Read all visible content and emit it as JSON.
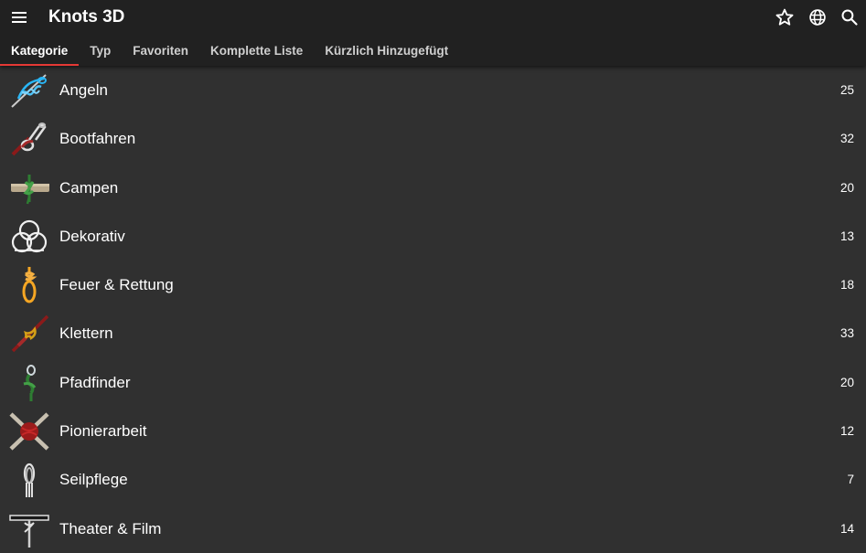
{
  "app": {
    "title": "Knots 3D"
  },
  "toolbar": {
    "menu_icon": "menu-icon",
    "actions": [
      "star-icon",
      "globe-icon",
      "search-icon"
    ]
  },
  "tabs": [
    {
      "label": "Kategorie",
      "active": true
    },
    {
      "label": "Typ",
      "active": false
    },
    {
      "label": "Favoriten",
      "active": false
    },
    {
      "label": "Komplette Liste",
      "active": false
    },
    {
      "label": "Kürzlich Hinzugefügt",
      "active": false
    }
  ],
  "categories": [
    {
      "label": "Angeln",
      "count": "25",
      "icon": "fishing-knot-icon"
    },
    {
      "label": "Bootfahren",
      "count": "32",
      "icon": "boating-knot-icon"
    },
    {
      "label": "Campen",
      "count": "20",
      "icon": "camping-knot-icon"
    },
    {
      "label": "Dekorativ",
      "count": "13",
      "icon": "decorative-knot-icon"
    },
    {
      "label": "Feuer & Rettung",
      "count": "18",
      "icon": "rescue-knot-icon"
    },
    {
      "label": "Klettern",
      "count": "33",
      "icon": "climbing-knot-icon"
    },
    {
      "label": "Pfadfinder",
      "count": "20",
      "icon": "scouting-knot-icon"
    },
    {
      "label": "Pionierarbeit",
      "count": "12",
      "icon": "pioneering-knot-icon"
    },
    {
      "label": "Seilpflege",
      "count": "7",
      "icon": "rope-care-icon"
    },
    {
      "label": "Theater & Film",
      "count": "14",
      "icon": "theater-knot-icon"
    }
  ],
  "colors": {
    "appbar": "#212121",
    "background": "#303030",
    "tab_indicator": "#e53935",
    "text": "#ffffff"
  }
}
